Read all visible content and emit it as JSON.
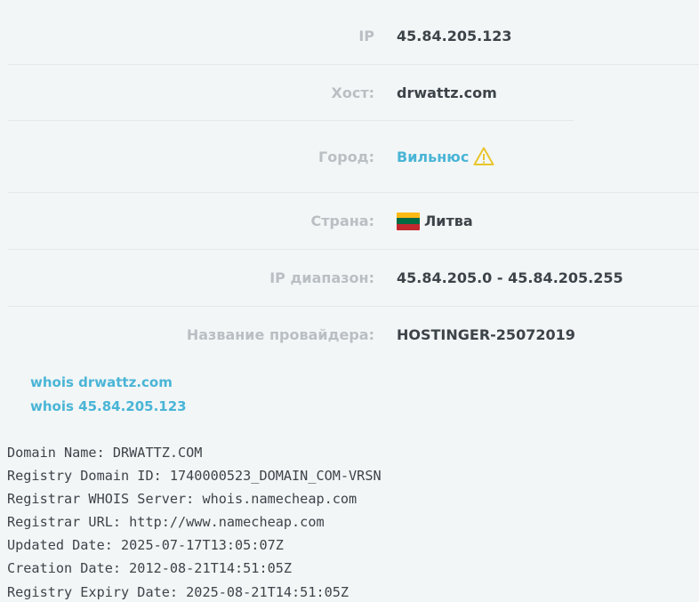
{
  "info": {
    "ip": {
      "label": "IP",
      "value": "45.84.205.123"
    },
    "host": {
      "label": "Хост:",
      "value": "drwattz.com"
    },
    "city": {
      "label": "Город:",
      "value": "Вильнюс",
      "icon": "warning-icon"
    },
    "country": {
      "label": "Страна:",
      "value": "Литва",
      "icon": "lithuania-flag-icon",
      "flag_colors": [
        "#fdb913",
        "#006a44",
        "#c1272d"
      ]
    },
    "ip_range": {
      "label": "IP диапазон:",
      "value": "45.84.205.0 - 45.84.205.255"
    },
    "provider": {
      "label": "Название провайдера:",
      "value": "HOSTINGER-25072019"
    }
  },
  "whois_links": [
    "whois drwattz.com",
    "whois 45.84.205.123"
  ],
  "whois_raw": [
    "Domain Name: DRWATTZ.COM",
    "Registry Domain ID: 1740000523_DOMAIN_COM-VRSN",
    "Registrar WHOIS Server: whois.namecheap.com",
    "Registrar URL: http://www.namecheap.com",
    "Updated Date: 2025-07-17T13:05:07Z",
    "Creation Date: 2012-08-21T14:51:05Z",
    "Registry Expiry Date: 2025-08-21T14:51:05Z"
  ],
  "colors": {
    "background": "#f3f6f7",
    "label": "#b9bfc3",
    "value": "#3d4449",
    "link": "#4ab5d6",
    "warning": "#e8c52a"
  }
}
